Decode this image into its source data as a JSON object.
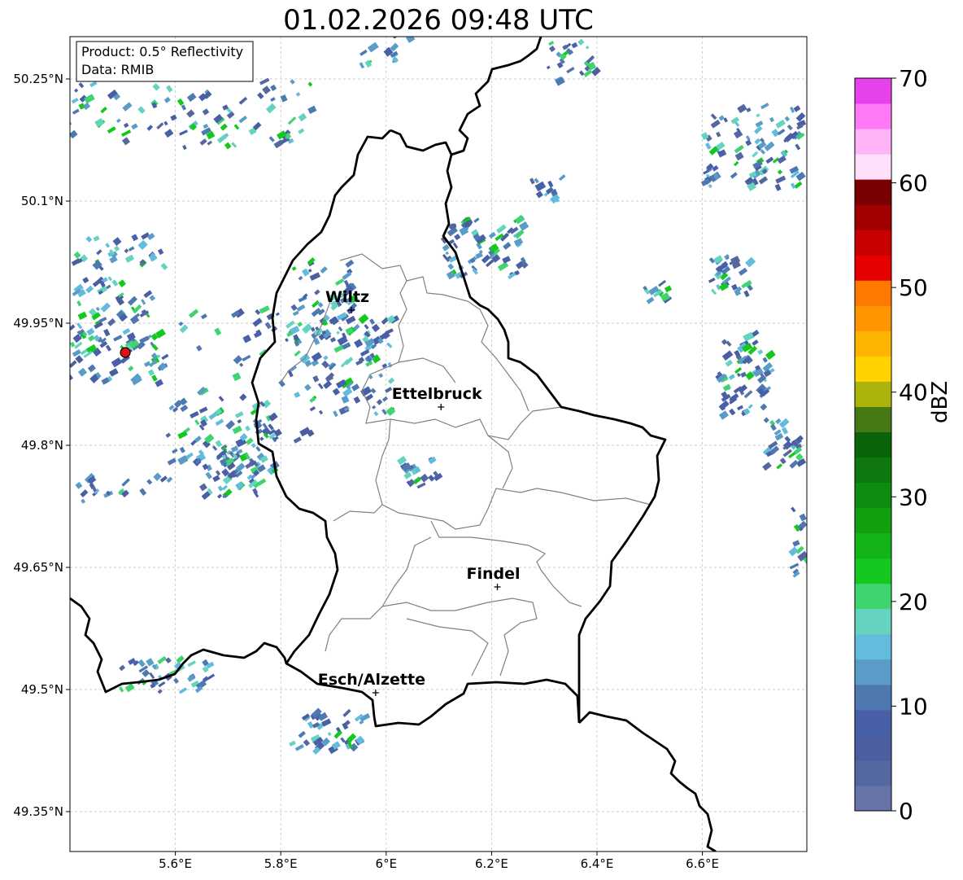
{
  "title": "01.02.2026 09:48 UTC",
  "info_box": {
    "line1": "Product: 0.5° Reflectivity",
    "line2": "Data: RMIB"
  },
  "axes": {
    "x_ticks": [
      "5.6°E",
      "5.8°E",
      "6°E",
      "6.2°E",
      "6.4°E",
      "6.6°E"
    ],
    "y_ticks": [
      "50.25°N",
      "50.1°N",
      "49.95°N",
      "49.8°N",
      "49.65°N",
      "49.5°N",
      "49.35°N"
    ],
    "lon_range": [
      5.4,
      6.8
    ],
    "lat_range": [
      49.3,
      50.3
    ],
    "grid": true
  },
  "cities": [
    {
      "name": "Wiltz",
      "lon": 5.934,
      "lat": 49.966
    },
    {
      "name": "Ettelbruck",
      "lon": 6.104,
      "lat": 49.847
    },
    {
      "name": "Findel",
      "lon": 6.211,
      "lat": 49.626
    },
    {
      "name": "Esch/Alzette",
      "lon": 5.98,
      "lat": 49.496
    }
  ],
  "radar_site": {
    "lon": 5.505,
    "lat": 49.914
  },
  "colorbar": {
    "label": "dBZ",
    "ticks": [
      "0",
      "10",
      "20",
      "30",
      "40",
      "50",
      "60",
      "70"
    ],
    "colors": [
      "#6674a8",
      "#5567a0",
      "#4a5ea0",
      "#4860a8",
      "#4e78b0",
      "#5a9cc8",
      "#64bcdc",
      "#64d4c0",
      "#40d470",
      "#14c820",
      "#12b418",
      "#10a010",
      "#0e8c10",
      "#0e780e",
      "#0a640a",
      "#467814",
      "#aab40a",
      "#ffd200",
      "#ffb400",
      "#ff9600",
      "#ff7800",
      "#e60000",
      "#c80000",
      "#a00000",
      "#780000",
      "#ffe0fa",
      "#ffb4fa",
      "#ff78f5",
      "#e641eb"
    ]
  }
}
